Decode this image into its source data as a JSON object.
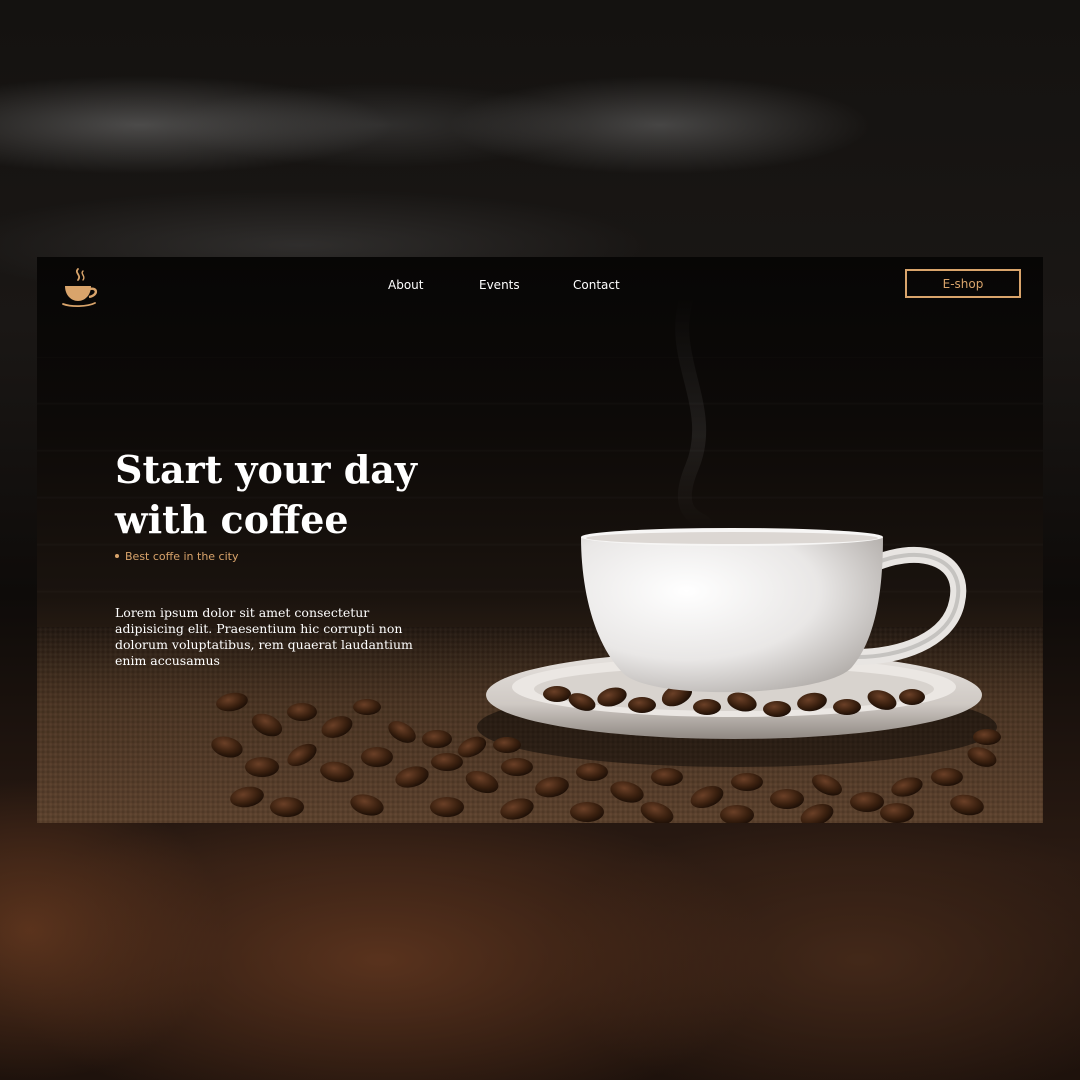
{
  "nav": {
    "links": [
      {
        "label": "About"
      },
      {
        "label": "Events"
      },
      {
        "label": "Contact"
      }
    ],
    "eshop_label": "E-shop"
  },
  "hero": {
    "title_line1": "Start your day",
    "title_line2": "with coffee",
    "tagline": "Best coffe in the city",
    "description": "Lorem ipsum dolor sit amet consectetur adipisicing elit. Praesentium hic corrupti non dolorum voluptatibus, rem quaerat laudantium enim accusamus"
  },
  "colors": {
    "accent": "#d9a46b",
    "text": "#ffffff",
    "background": "#0d0907"
  },
  "icons": {
    "logo": "coffee-cup-icon"
  }
}
